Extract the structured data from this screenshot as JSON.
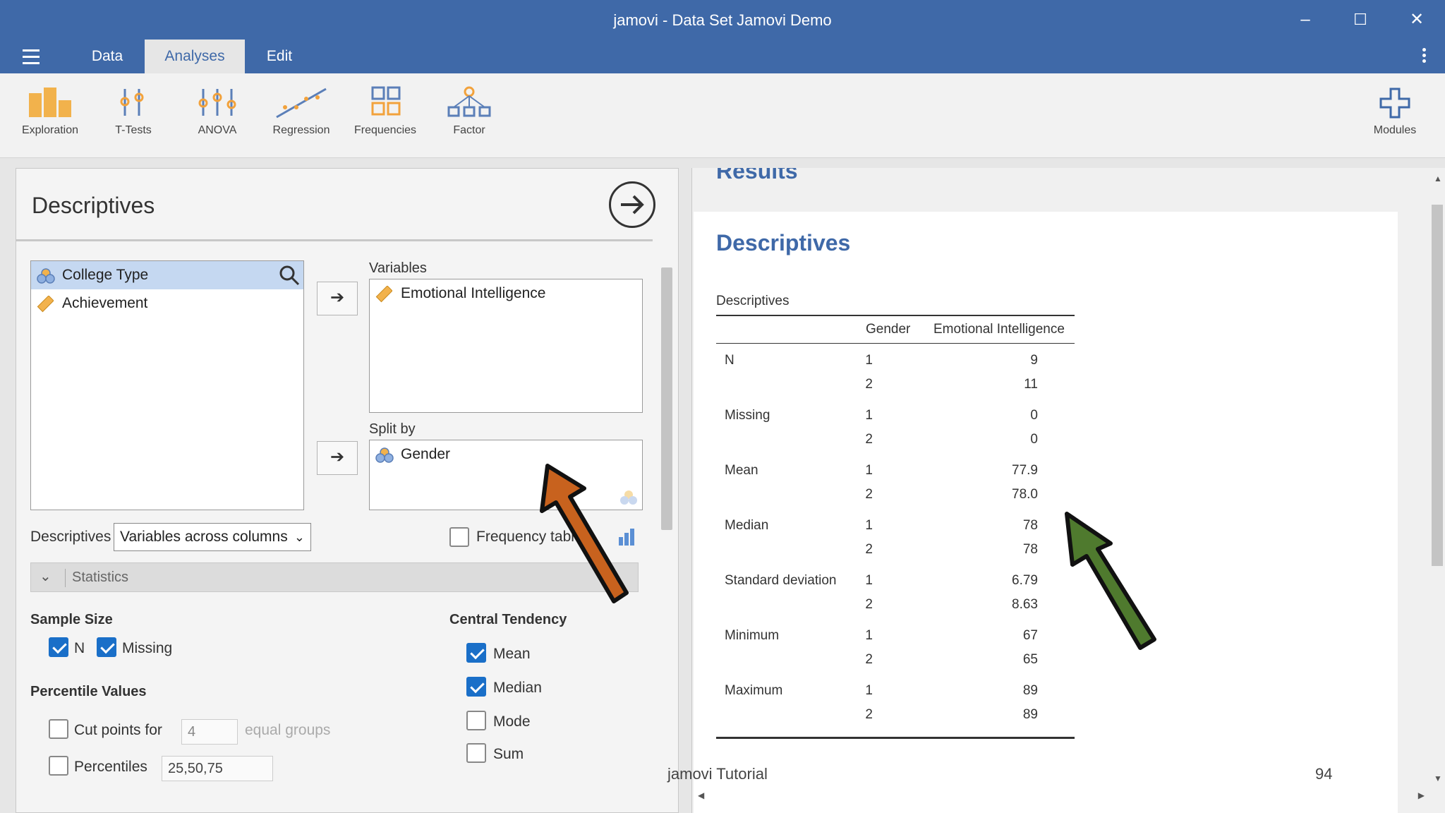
{
  "window": {
    "title": "jamovi - Data Set Jamovi Demo"
  },
  "tabs": [
    "Data",
    "Analyses",
    "Edit"
  ],
  "ribbon": {
    "buttons": [
      "Exploration",
      "T-Tests",
      "ANOVA",
      "Regression",
      "Frequencies",
      "Factor"
    ],
    "modules": "Modules"
  },
  "analysis": {
    "title": "Descriptives",
    "source_vars": [
      "College Type",
      "Achievement"
    ],
    "variables_label": "Variables",
    "variables": [
      "Emotional Intelligence"
    ],
    "splitby_label": "Split by",
    "splitby": [
      "Gender"
    ],
    "descriptives_label": "Descriptives",
    "descriptives_select": "Variables across columns",
    "frequency_tables_label": "Frequency tables",
    "statistics_label": "Statistics",
    "sample_size": {
      "heading": "Sample Size",
      "n": "N",
      "missing": "Missing"
    },
    "percentile": {
      "heading": "Percentile Values",
      "cut_points_label": "Cut points for",
      "cut_points_value": "4",
      "equal_groups": "equal groups",
      "percentiles_label": "Percentiles",
      "percentiles_value": "25,50,75"
    },
    "central_tendency": {
      "heading": "Central Tendency",
      "mean": "Mean",
      "median": "Median",
      "mode": "Mode",
      "sum": "Sum"
    }
  },
  "results": {
    "section_label": "Results",
    "heading": "Descriptives",
    "table_title": "Descriptives",
    "col_gender": "Gender",
    "col_var": "Emotional Intelligence",
    "rows": [
      {
        "stat": "N",
        "g1": "1",
        "v1": "9",
        "g2": "2",
        "v2": "11"
      },
      {
        "stat": "Missing",
        "g1": "1",
        "v1": "0",
        "g2": "2",
        "v2": "0"
      },
      {
        "stat": "Mean",
        "g1": "1",
        "v1": "77.9",
        "g2": "2",
        "v2": "78.0"
      },
      {
        "stat": "Median",
        "g1": "1",
        "v1": "78",
        "g2": "2",
        "v2": "78"
      },
      {
        "stat": "Standard deviation",
        "g1": "1",
        "v1": "6.79",
        "g2": "2",
        "v2": "8.63"
      },
      {
        "stat": "Minimum",
        "g1": "1",
        "v1": "67",
        "g2": "2",
        "v2": "65"
      },
      {
        "stat": "Maximum",
        "g1": "1",
        "v1": "89",
        "g2": "2",
        "v2": "89"
      }
    ]
  },
  "footer": {
    "left": "jamovi Tutorial",
    "right": "94"
  },
  "colors": {
    "brand": "#3f69a8",
    "check": "#1a6fc8",
    "arrow_orange": "#c8621e",
    "arrow_green": "#4f7a2e"
  }
}
